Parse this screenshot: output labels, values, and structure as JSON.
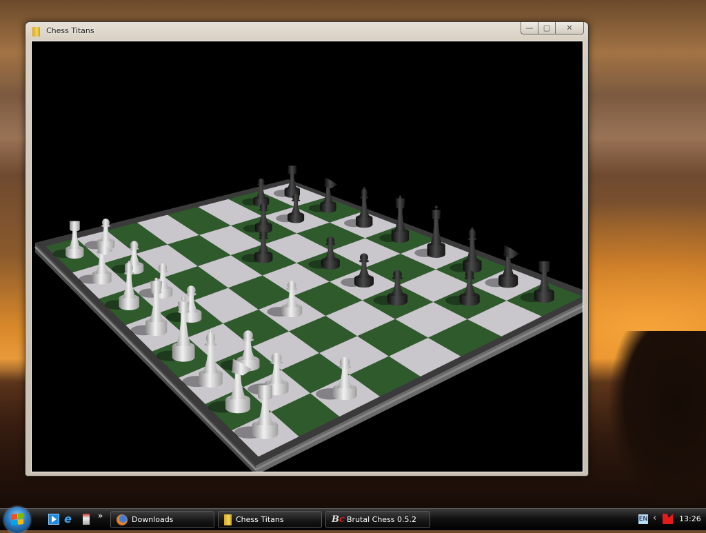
{
  "window": {
    "title": "Chess Titans",
    "buttons": {
      "minimize": "—",
      "maximize": "▢",
      "close": "✕"
    }
  },
  "board": {
    "light_square": "#c9c6cc",
    "dark_square": "#2f5a2c",
    "frame_color": "#3a3a3a",
    "background": "#000000",
    "pieces": [
      {
        "color": "white",
        "type": "rook",
        "square": "a1"
      },
      {
        "color": "white",
        "type": "knight",
        "square": "b1"
      },
      {
        "color": "white",
        "type": "bishop",
        "square": "c1"
      },
      {
        "color": "white",
        "type": "queen",
        "square": "d1"
      },
      {
        "color": "white",
        "type": "king",
        "square": "e1"
      },
      {
        "color": "white",
        "type": "bishop",
        "square": "f1"
      },
      {
        "color": "white",
        "type": "knight",
        "square": "g1"
      },
      {
        "color": "white",
        "type": "rook",
        "square": "h1"
      },
      {
        "color": "white",
        "type": "pawn",
        "square": "a2"
      },
      {
        "color": "white",
        "type": "pawn",
        "square": "b2"
      },
      {
        "color": "white",
        "type": "pawn",
        "square": "c2"
      },
      {
        "color": "white",
        "type": "pawn",
        "square": "d2"
      },
      {
        "color": "white",
        "type": "pawn",
        "square": "e4"
      },
      {
        "color": "white",
        "type": "pawn",
        "square": "f2"
      },
      {
        "color": "white",
        "type": "pawn",
        "square": "g2"
      },
      {
        "color": "white",
        "type": "pawn",
        "square": "h3"
      },
      {
        "color": "black",
        "type": "rook",
        "square": "a8"
      },
      {
        "color": "black",
        "type": "knight",
        "square": "b8"
      },
      {
        "color": "black",
        "type": "bishop",
        "square": "c8"
      },
      {
        "color": "black",
        "type": "queen",
        "square": "d8"
      },
      {
        "color": "black",
        "type": "king",
        "square": "e8"
      },
      {
        "color": "black",
        "type": "bishop",
        "square": "f8"
      },
      {
        "color": "black",
        "type": "knight",
        "square": "g8"
      },
      {
        "color": "black",
        "type": "rook",
        "square": "h8"
      },
      {
        "color": "black",
        "type": "pawn",
        "square": "a7"
      },
      {
        "color": "black",
        "type": "pawn",
        "square": "b6"
      },
      {
        "color": "black",
        "type": "pawn",
        "square": "b7"
      },
      {
        "color": "black",
        "type": "pawn",
        "square": "c5"
      },
      {
        "color": "black",
        "type": "pawn",
        "square": "d6"
      },
      {
        "color": "black",
        "type": "pawn",
        "square": "e6"
      },
      {
        "color": "black",
        "type": "pawn",
        "square": "f6"
      },
      {
        "color": "black",
        "type": "pawn",
        "square": "g7"
      }
    ]
  },
  "taskbar": {
    "quick_launch": [
      "media-player-icon",
      "internet-explorer-icon",
      "utility-icon"
    ],
    "overflow": "»",
    "tasks": [
      {
        "label": "Downloads",
        "icon": "firefox-icon"
      },
      {
        "label": "Chess Titans",
        "icon": "folder-icon"
      },
      {
        "label": "Brutal Chess 0.5.2",
        "icon": "brutal-chess-icon"
      }
    ],
    "tray": {
      "language": "EN",
      "show_hidden": "‹",
      "clock": "13:26"
    }
  }
}
